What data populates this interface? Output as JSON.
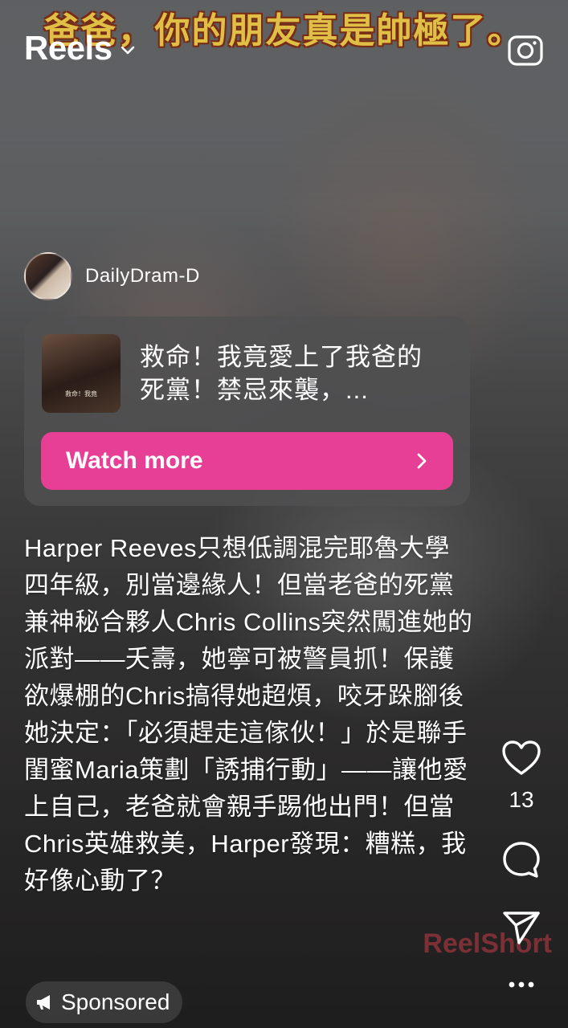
{
  "overlay_caption": "爸爸，你的朋友真是帥極了。",
  "header": {
    "title": "Reels",
    "title_chevron_icon": "chevron-down-icon",
    "camera_icon": "camera-icon"
  },
  "author": {
    "name": "DailyDram-D",
    "avatar_icon": "avatar"
  },
  "card": {
    "thumbnail_text": "救命！我竟",
    "title": "救命！我竟愛上了我爸的死黨！禁忌來襲，...",
    "button_label": "Watch more",
    "button_icon": "chevron-right-icon",
    "button_color": "#e63f95"
  },
  "description": "Harper Reeves只想低調混完耶魯大學四年級，別當邊緣人！但當老爸的死黨兼神秘合夥人Chris Collins突然闖進她的派對——夭壽，她寧可被警員抓！保護欲爆棚的Chris搞得她超煩，咬牙跺腳後她決定：「必須趕走這傢伙！」於是聯手閨蜜Maria策劃「誘捕行動」——讓他愛上自己，老爸就會親手踢他出門！但當Chris英雄救美，Harper發現：糟糕，我好像心動了？",
  "sponsored": {
    "label": "Sponsored",
    "icon": "megaphone-icon"
  },
  "actions": {
    "like_icon": "heart-icon",
    "like_count": "13",
    "comment_icon": "comment-icon",
    "share_icon": "send-icon",
    "more_icon": "more-icon"
  },
  "watermark": "ReelShort"
}
